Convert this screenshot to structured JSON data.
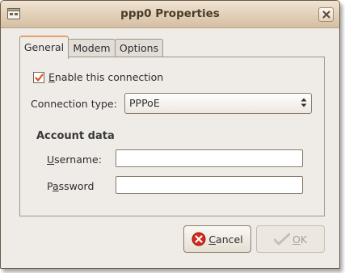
{
  "window": {
    "title": "ppp0 Properties",
    "title_icon": "network-settings-icon",
    "close_icon": "close-icon"
  },
  "tabs": [
    {
      "label": "General",
      "active": true
    },
    {
      "label": "Modem",
      "active": false
    },
    {
      "label": "Options",
      "active": false
    }
  ],
  "general": {
    "enable": {
      "mnemonic": "E",
      "label_rest": "nable this connection",
      "checked": true
    },
    "connection_type": {
      "label": "Connection type:",
      "value": "PPPoE"
    },
    "account": {
      "title": "Account data",
      "username": {
        "mnemonic": "U",
        "label_rest": "sername:",
        "value": ""
      },
      "password": {
        "mnemonic_pre": "P",
        "mnemonic": "a",
        "label_rest": "ssword",
        "value": ""
      }
    }
  },
  "buttons": {
    "cancel": {
      "mnemonic": "C",
      "label_rest": "ancel",
      "icon": "cancel-icon"
    },
    "ok": {
      "mnemonic": "O",
      "label_rest": "K",
      "icon": "ok-icon",
      "enabled": false
    }
  },
  "colors": {
    "titlebar": "#e4d2bb",
    "window_bg": "#efebe7",
    "accent": "#e8a06a",
    "check": "#d9561c",
    "cancel_red": "#d42a1c"
  }
}
